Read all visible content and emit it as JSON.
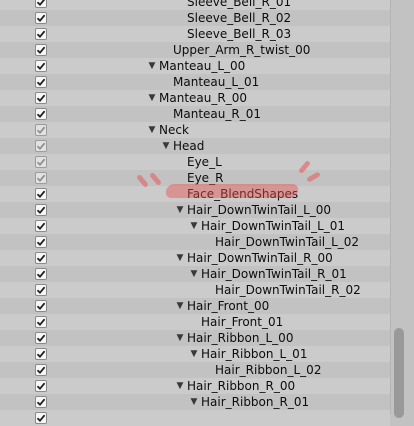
{
  "tree_items": [
    {
      "label": "Sleeve_Bell_R_01",
      "depth": 3,
      "arrow": false,
      "dim": false
    },
    {
      "label": "Sleeve_Bell_R_02",
      "depth": 3,
      "arrow": false,
      "dim": false
    },
    {
      "label": "Sleeve_Bell_R_03",
      "depth": 3,
      "arrow": false,
      "dim": false
    },
    {
      "label": "Upper_Arm_R_twist_00",
      "depth": 2,
      "arrow": false,
      "dim": false
    },
    {
      "label": "Manteau_L_00",
      "depth": 1,
      "arrow": true,
      "dim": false
    },
    {
      "label": "Manteau_L_01",
      "depth": 2,
      "arrow": false,
      "dim": false
    },
    {
      "label": "Manteau_R_00",
      "depth": 1,
      "arrow": true,
      "dim": false
    },
    {
      "label": "Manteau_R_01",
      "depth": 2,
      "arrow": false,
      "dim": false
    },
    {
      "label": "Neck",
      "depth": 1,
      "arrow": true,
      "dim": true
    },
    {
      "label": "Head",
      "depth": 2,
      "arrow": true,
      "dim": true
    },
    {
      "label": "Eye_L",
      "depth": 3,
      "arrow": false,
      "dim": true
    },
    {
      "label": "Eye_R",
      "depth": 3,
      "arrow": false,
      "dim": true
    },
    {
      "label": "Face_BlendShapes",
      "depth": 3,
      "arrow": false,
      "dim": false
    },
    {
      "label": "Hair_DownTwinTail_L_00",
      "depth": 3,
      "arrow": true,
      "dim": false
    },
    {
      "label": "Hair_DownTwinTail_L_01",
      "depth": 4,
      "arrow": true,
      "dim": false
    },
    {
      "label": "Hair_DownTwinTail_L_02",
      "depth": 5,
      "arrow": false,
      "dim": false
    },
    {
      "label": "Hair_DownTwinTail_R_00",
      "depth": 3,
      "arrow": true,
      "dim": false
    },
    {
      "label": "Hair_DownTwinTail_R_01",
      "depth": 4,
      "arrow": true,
      "dim": false
    },
    {
      "label": "Hair_DownTwinTail_R_02",
      "depth": 5,
      "arrow": false,
      "dim": false
    },
    {
      "label": "Hair_Front_00",
      "depth": 3,
      "arrow": true,
      "dim": false
    },
    {
      "label": "Hair_Front_01",
      "depth": 4,
      "arrow": false,
      "dim": false
    },
    {
      "label": "Hair_Ribbon_L_00",
      "depth": 3,
      "arrow": true,
      "dim": false
    },
    {
      "label": "Hair_Ribbon_L_01",
      "depth": 4,
      "arrow": true,
      "dim": false
    },
    {
      "label": "Hair_Ribbon_L_02",
      "depth": 5,
      "arrow": false,
      "dim": false
    },
    {
      "label": "Hair_Ribbon_R_00",
      "depth": 3,
      "arrow": true,
      "dim": false
    },
    {
      "label": "Hair_Ribbon_R_01",
      "depth": 4,
      "arrow": true,
      "dim": false
    },
    {
      "label": "",
      "depth": 5,
      "arrow": false,
      "dim": false
    }
  ],
  "icons": {
    "checkbox": "checkmark-icon",
    "expand": "triangle-down-icon"
  },
  "colors": {
    "highlight": "#e85050",
    "background": "#c2c2c2",
    "row_alt": "#cbcbcb"
  }
}
